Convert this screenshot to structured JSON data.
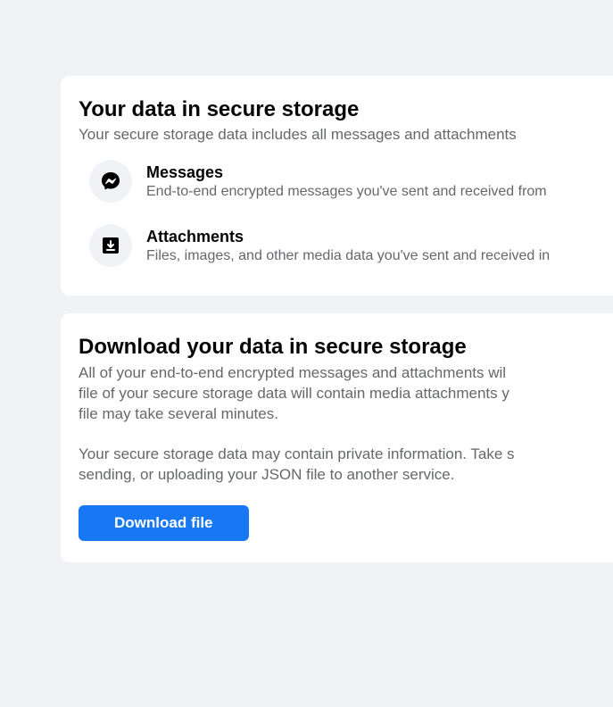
{
  "card1": {
    "title": "Your data in secure storage",
    "subtitle": "Your secure storage data includes all messages and attachments",
    "items": [
      {
        "title": "Messages",
        "desc": "End-to-end encrypted messages you've sent and received from"
      },
      {
        "title": "Attachments",
        "desc": "Files, images, and other media data you've sent and received in"
      }
    ]
  },
  "card2": {
    "title": "Download your data in secure storage",
    "para1_line1": "All of your end-to-end encrypted messages and attachments wil",
    "para1_line2": "file of your secure storage data will contain media attachments y",
    "para1_line3": "file may take several minutes.",
    "para2_line1": "Your secure storage data may contain private information. Take s",
    "para2_line2": "sending, or uploading your JSON file to another service.",
    "button_label": "Download file"
  }
}
